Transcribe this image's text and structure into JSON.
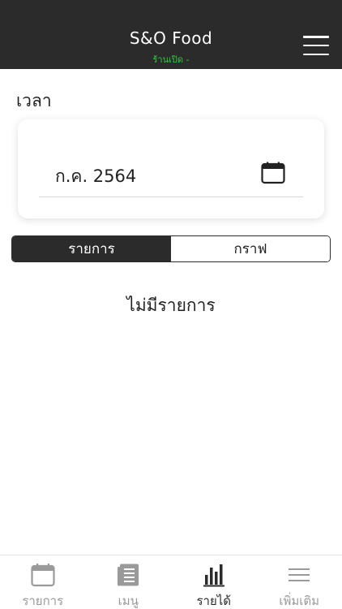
{
  "header": {
    "title": "S&O Food",
    "status": "ร้านเปิด -",
    "menu_icon": "hamburger-menu-icon"
  },
  "section": {
    "label": "เวลา"
  },
  "date_picker": {
    "value": "ก.ค. 2564",
    "icon": "calendar-icon"
  },
  "view_toggle": {
    "options": [
      "รายการ",
      "กราฟ"
    ],
    "selected": "รายการ"
  },
  "empty_state": {
    "text": "ไม่มีรายการ"
  },
  "tabbar": {
    "items": [
      {
        "label": "รายการ",
        "icon": "calendar-icon",
        "active": false
      },
      {
        "label": "เมนู",
        "icon": "document-list-icon",
        "active": false
      },
      {
        "label": "รายได้",
        "icon": "bar-chart-icon",
        "active": true
      },
      {
        "label": "เพิ่มเติม",
        "icon": "more-lines-icon",
        "active": false
      }
    ]
  },
  "colors": {
    "header_bg": "#2b2b2b",
    "status_green": "#2ecc40",
    "inactive_tab": "#9a9a9a"
  }
}
